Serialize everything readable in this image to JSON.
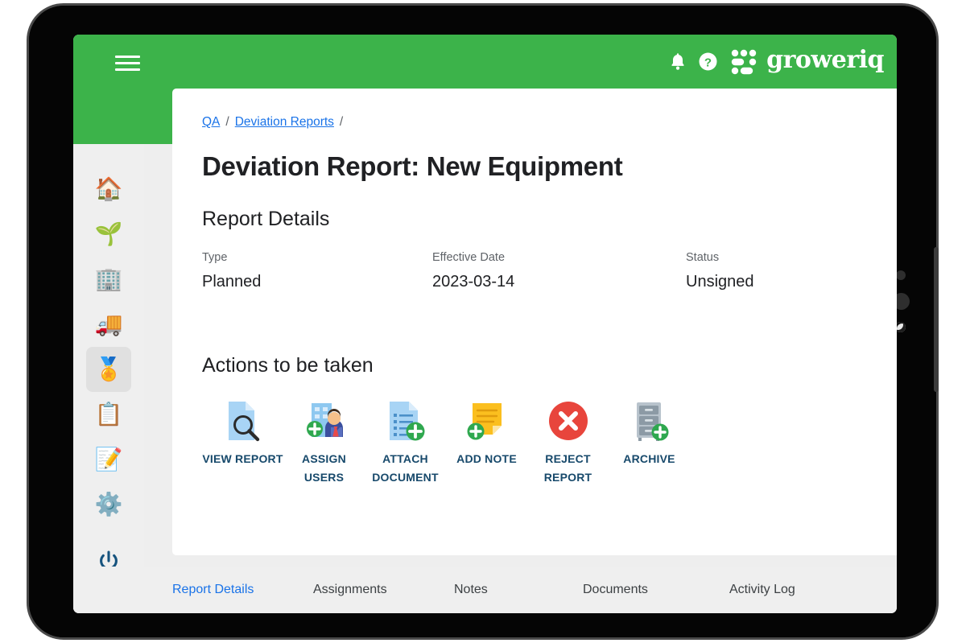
{
  "topbar": {
    "menu_icon": "hamburger-icon",
    "bell_icon": "bell-icon",
    "help_icon": "help-circle-icon",
    "logo_text": "groweriq",
    "brand_color": "#3cb34a"
  },
  "sidebar": {
    "items": [
      {
        "name": "home",
        "glyph": "🏠",
        "active": false
      },
      {
        "name": "cultivation",
        "glyph": "🌱",
        "active": false
      },
      {
        "name": "facility",
        "glyph": "🏢",
        "active": false
      },
      {
        "name": "inventory",
        "glyph": "🚚",
        "active": false
      },
      {
        "name": "quality",
        "glyph": "🏅",
        "active": true
      },
      {
        "name": "reports",
        "glyph": "📋",
        "active": false
      },
      {
        "name": "documents",
        "glyph": "📝",
        "active": false
      },
      {
        "name": "settings",
        "glyph": "⚙️",
        "active": false
      }
    ],
    "logout_icon": "power-icon"
  },
  "breadcrumb": {
    "items": [
      "QA",
      "Deviation Reports"
    ],
    "separator": "/",
    "link_color": "#1a73e8"
  },
  "main": {
    "page_title": "Deviation Report: New Equipment",
    "report_details_heading": "Report Details",
    "details": [
      {
        "label": "Type",
        "value": "Planned"
      },
      {
        "label": "Effective Date",
        "value": "2023-03-14"
      },
      {
        "label": "Status",
        "value": "Unsigned"
      }
    ],
    "actions_heading": "Actions to be taken",
    "actions": [
      {
        "name": "view-report",
        "label": "VIEW REPORT",
        "icon": "document-search-icon"
      },
      {
        "name": "assign-users",
        "label": "ASSIGN USERS",
        "icon": "building-user-add-icon"
      },
      {
        "name": "attach-document",
        "label": "ATTACH DOCUMENT",
        "icon": "document-add-icon"
      },
      {
        "name": "add-note",
        "label": "ADD NOTE",
        "icon": "note-add-icon"
      },
      {
        "name": "reject-report",
        "label": "REJECT REPORT",
        "icon": "reject-x-icon"
      },
      {
        "name": "archive",
        "label": "ARCHIVE",
        "icon": "file-cabinet-add-icon"
      }
    ],
    "action_label_color": "#17496b"
  },
  "tabs": [
    {
      "label": "Report Details",
      "active": true
    },
    {
      "label": "Assignments",
      "active": false
    },
    {
      "label": "Notes",
      "active": false
    },
    {
      "label": "Documents",
      "active": false
    },
    {
      "label": "Activity Log",
      "active": false
    }
  ]
}
